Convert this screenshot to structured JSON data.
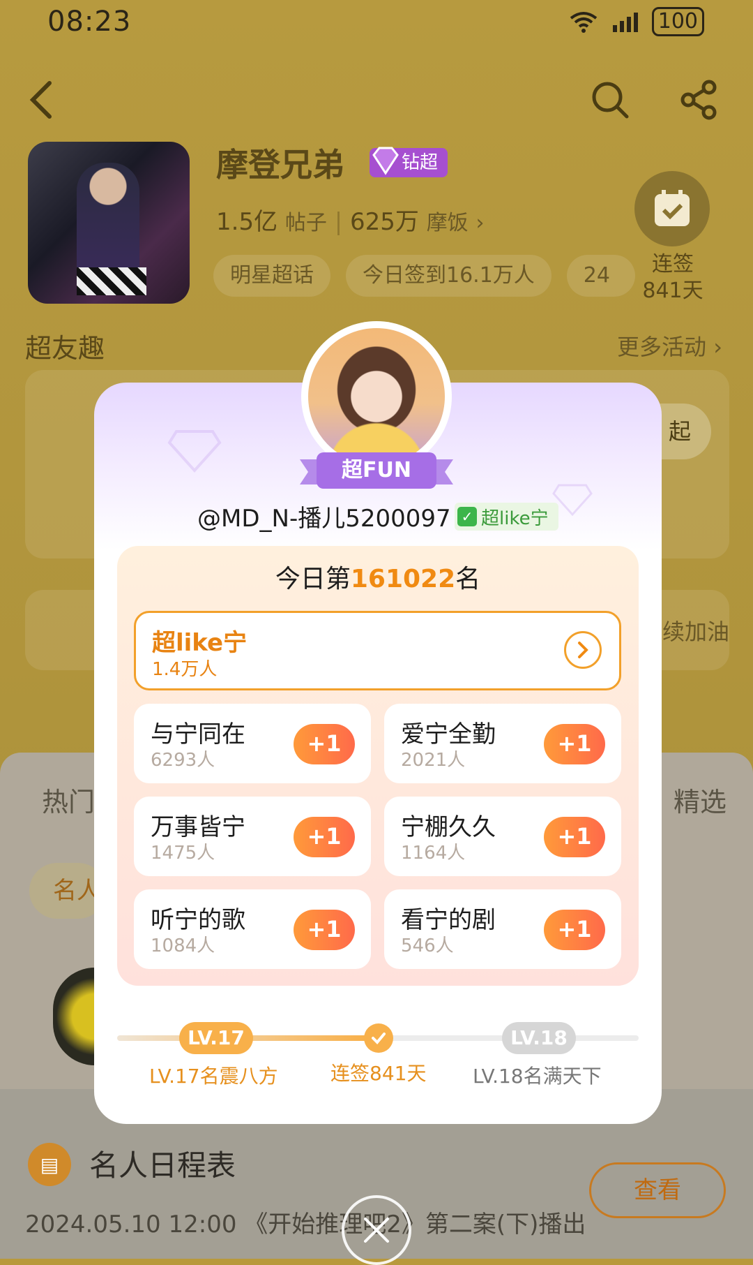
{
  "status": {
    "time": "08:23",
    "wifi": "6",
    "battery": "100"
  },
  "community": {
    "name": "摩登兄弟",
    "badge": "钻超",
    "posts_value": "1.5亿",
    "posts_label": "帖子",
    "fans_value": "625万",
    "fans_label": "摩饭",
    "tags": [
      "明星超话",
      "今日签到16.1万人",
      "24"
    ],
    "signin_label": "连签",
    "signin_days": "841天"
  },
  "section": {
    "title": "超友趣",
    "more": "更多活动"
  },
  "background_snippets": {
    "side_button": "起",
    "side_text": "续加油"
  },
  "lower": {
    "tab_left": "热门",
    "tab_right": "精选",
    "chip": "名人",
    "schedule_title": "名人日程表",
    "schedule_text": "2024.05.10 12:00 《开始推理吧2》第二案(下)播出",
    "view_button": "查看"
  },
  "modal": {
    "fun_badge": "超FUN",
    "username": "@MD_N-播儿5200097",
    "user_tag": "超like宁",
    "rank_prefix": "今日第",
    "rank_number": "161022",
    "rank_suffix": "名",
    "main_item": {
      "label": "超like宁",
      "count": "1.4万人"
    },
    "items": [
      {
        "label": "与宁同在",
        "count": "6293人",
        "button": "+1"
      },
      {
        "label": "爱宁全勤",
        "count": "2021人",
        "button": "+1"
      },
      {
        "label": "万事皆宁",
        "count": "1475人",
        "button": "+1"
      },
      {
        "label": "宁棚久久",
        "count": "1164人",
        "button": "+1"
      },
      {
        "label": "听宁的歌",
        "count": "1084人",
        "button": "+1"
      },
      {
        "label": "看宁的剧",
        "count": "546人",
        "button": "+1"
      }
    ],
    "progress": {
      "current_level": "LV.17",
      "next_level": "LV.18",
      "current_label": "LV.17名震八方",
      "middle_label": "连签841天",
      "next_label": "LV.18名满天下"
    }
  },
  "colors": {
    "accent": "#f08a12",
    "brand_purple": "#a64fd0",
    "overlay": "#b8993c"
  }
}
